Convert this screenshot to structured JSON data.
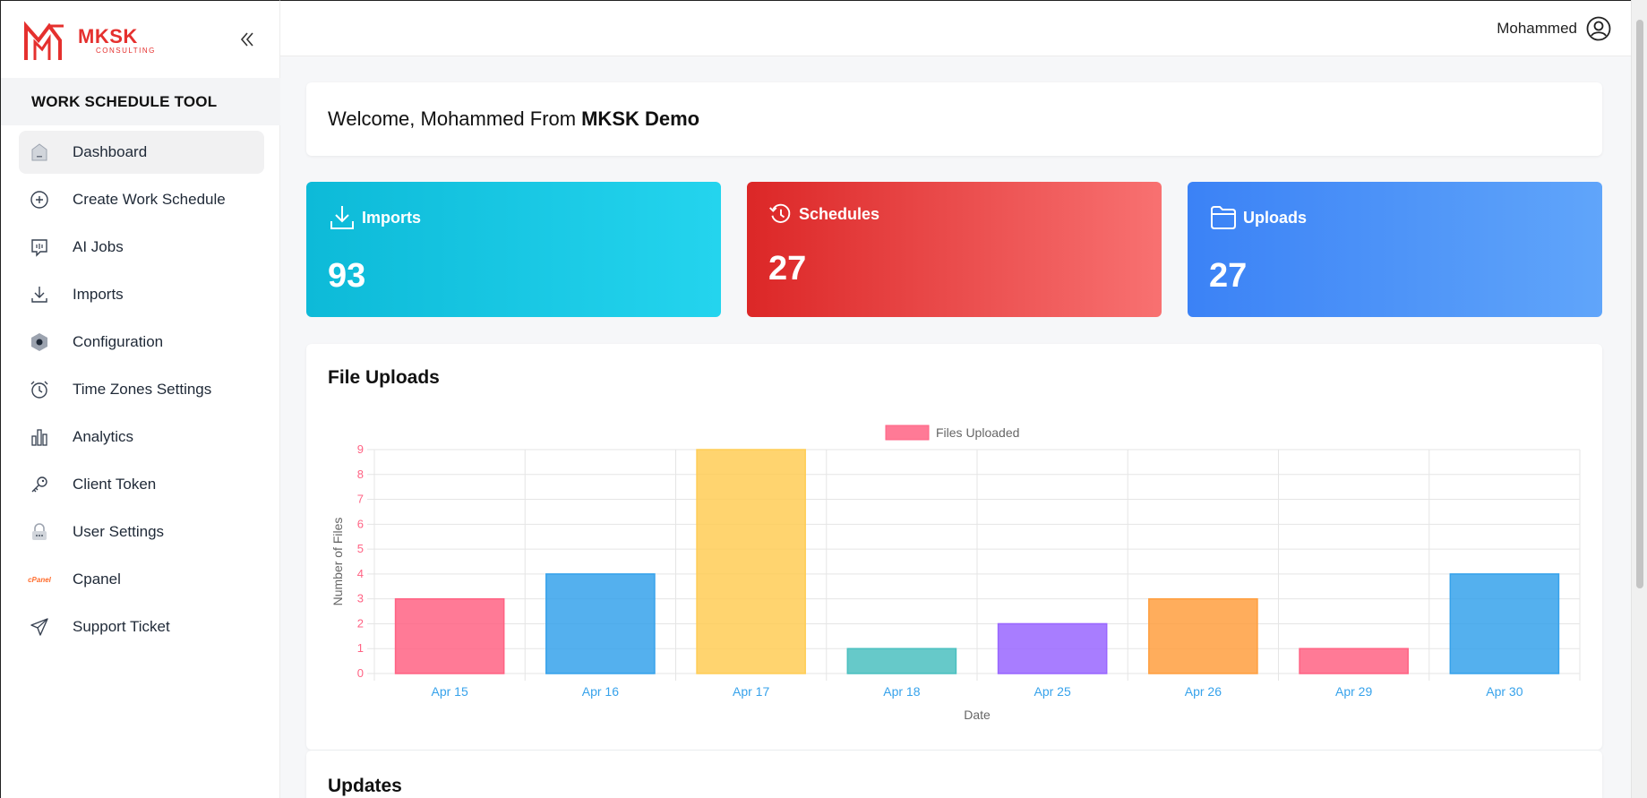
{
  "sidebar": {
    "logo": {
      "main": "MKSK",
      "sub": "CONSULTING"
    },
    "tool_title": "WORK SCHEDULE TOOL",
    "items": [
      {
        "label": "Dashboard",
        "icon": "home-icon"
      },
      {
        "label": "Create Work Schedule",
        "icon": "plus-circle-icon"
      },
      {
        "label": "AI Jobs",
        "icon": "chat-bubble-icon"
      },
      {
        "label": "Imports",
        "icon": "download-icon"
      },
      {
        "label": "Configuration",
        "icon": "hexagon-icon"
      },
      {
        "label": "Time Zones Settings",
        "icon": "alarm-clock-icon"
      },
      {
        "label": "Analytics",
        "icon": "bar-chart-icon"
      },
      {
        "label": "Client Token",
        "icon": "key-icon"
      },
      {
        "label": "User Settings",
        "icon": "lock-icon"
      },
      {
        "label": "Cpanel",
        "icon": "cpanel-logo-icon",
        "glyph": "cPanel"
      },
      {
        "label": "Support Ticket",
        "icon": "paper-plane-icon"
      }
    ]
  },
  "header": {
    "user_name": "Mohammed"
  },
  "welcome": {
    "prefix": "Welcome, Mohammed From",
    "org": "MKSK Demo"
  },
  "stats": {
    "imports": {
      "label": "Imports",
      "value": "93",
      "icon": "tray-download-icon"
    },
    "schedules": {
      "label": "Schedules",
      "value": "27",
      "icon": "clock-history-icon"
    },
    "uploads": {
      "label": "Uploads",
      "value": "27",
      "icon": "folder-icon"
    }
  },
  "file_uploads": {
    "title": "File Uploads"
  },
  "updates": {
    "title": "Updates"
  },
  "colors": {
    "pink": "#ff6384",
    "blue": "#36a2eb",
    "yellow": "#ffcd56",
    "teal": "#4bc0c0",
    "purple": "#9966ff",
    "orange": "#ff9f40",
    "tick_y": "#ff6384",
    "tick_x": "#36a2eb"
  },
  "chart_data": {
    "type": "bar",
    "categories": [
      "Apr 15",
      "Apr 16",
      "Apr 17",
      "Apr 18",
      "Apr 25",
      "Apr 26",
      "Apr 29",
      "Apr 30"
    ],
    "series": [
      {
        "name": "Files Uploaded",
        "values": [
          3,
          4,
          9,
          1,
          2,
          3,
          1,
          4
        ]
      }
    ],
    "bar_colors": [
      "#ff6384",
      "#36a2eb",
      "#ffcd56",
      "#4bc0c0",
      "#9966ff",
      "#ff9f40",
      "#ff6384",
      "#36a2eb"
    ],
    "xlabel": "Date",
    "ylabel": "Number of Files",
    "ylim": [
      0,
      9
    ],
    "yticks": [
      "0",
      "1",
      "2",
      "3",
      "4",
      "5",
      "6",
      "7",
      "8",
      "9"
    ],
    "grid": true,
    "legend": "top-center"
  }
}
